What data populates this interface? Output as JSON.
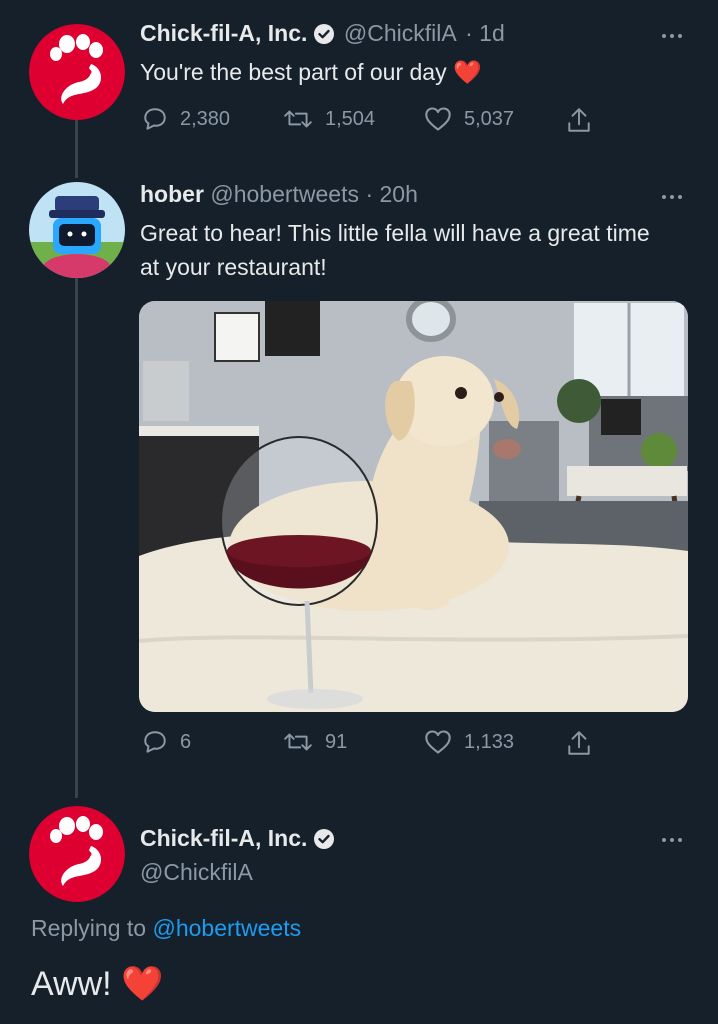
{
  "tweet1": {
    "name": "Chick-fil-A, Inc.",
    "handle": "@ChickfilA",
    "time": "· 1d",
    "text": "You're the best part of our day",
    "emoji": "❤️",
    "replies": "2,380",
    "retweets": "1,504",
    "likes": "5,037"
  },
  "tweet2": {
    "name": "hober",
    "handle": "@hobertweets",
    "time": "· 20h",
    "text": "Great to hear! This little fella will have a great time at your restaurant!",
    "replies": "6",
    "retweets": "91",
    "likes": "1,133"
  },
  "tweet3": {
    "name": "Chick-fil-A, Inc.",
    "handle": "@ChickfilA",
    "replying_prefix": "Replying to",
    "replying_handle": "@hobertweets",
    "text": "Aww!",
    "emoji": "❤️"
  },
  "colors": {
    "background": "#15202b",
    "text": "#e7e9ea",
    "secondary": "#8b98a5",
    "link": "#1d9bf0",
    "brand_red": "#dd0031"
  }
}
